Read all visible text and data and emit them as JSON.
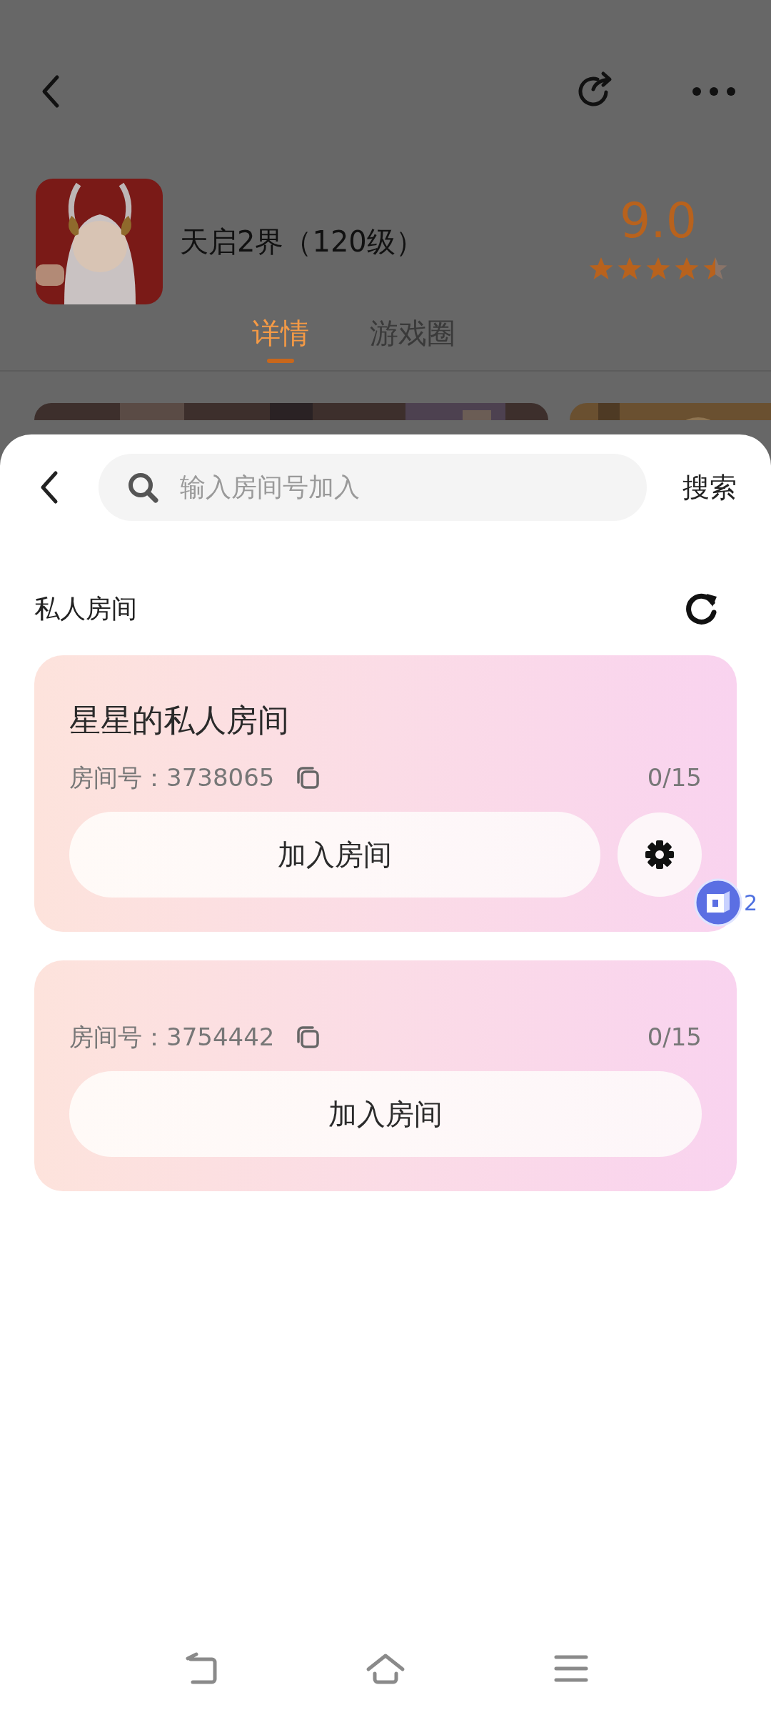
{
  "background_page": {
    "title": "天启2界（120级）",
    "rating": "9.0",
    "stars": 4.5,
    "tabs": [
      {
        "label": "详情",
        "selected": true
      },
      {
        "label": "游戏圈",
        "selected": false
      }
    ],
    "banners": [
      {
        "kind": "picture"
      },
      {
        "kind": "picture"
      }
    ]
  },
  "sheet": {
    "search": {
      "placeholder": "输入房间号加入"
    },
    "search_button": "搜索",
    "section_title": "私人房间",
    "rooms": [
      {
        "name": "星星的私人房间",
        "room_number": "房间号：3738065",
        "occupancy": "0/15",
        "join_button": "加入房间",
        "settings": true
      },
      {
        "room_number": "房间号：3754442",
        "occupancy": "0/15",
        "join_button": "加入房间",
        "settings": false
      }
    ]
  },
  "floating_ball": {
    "count": "2"
  }
}
